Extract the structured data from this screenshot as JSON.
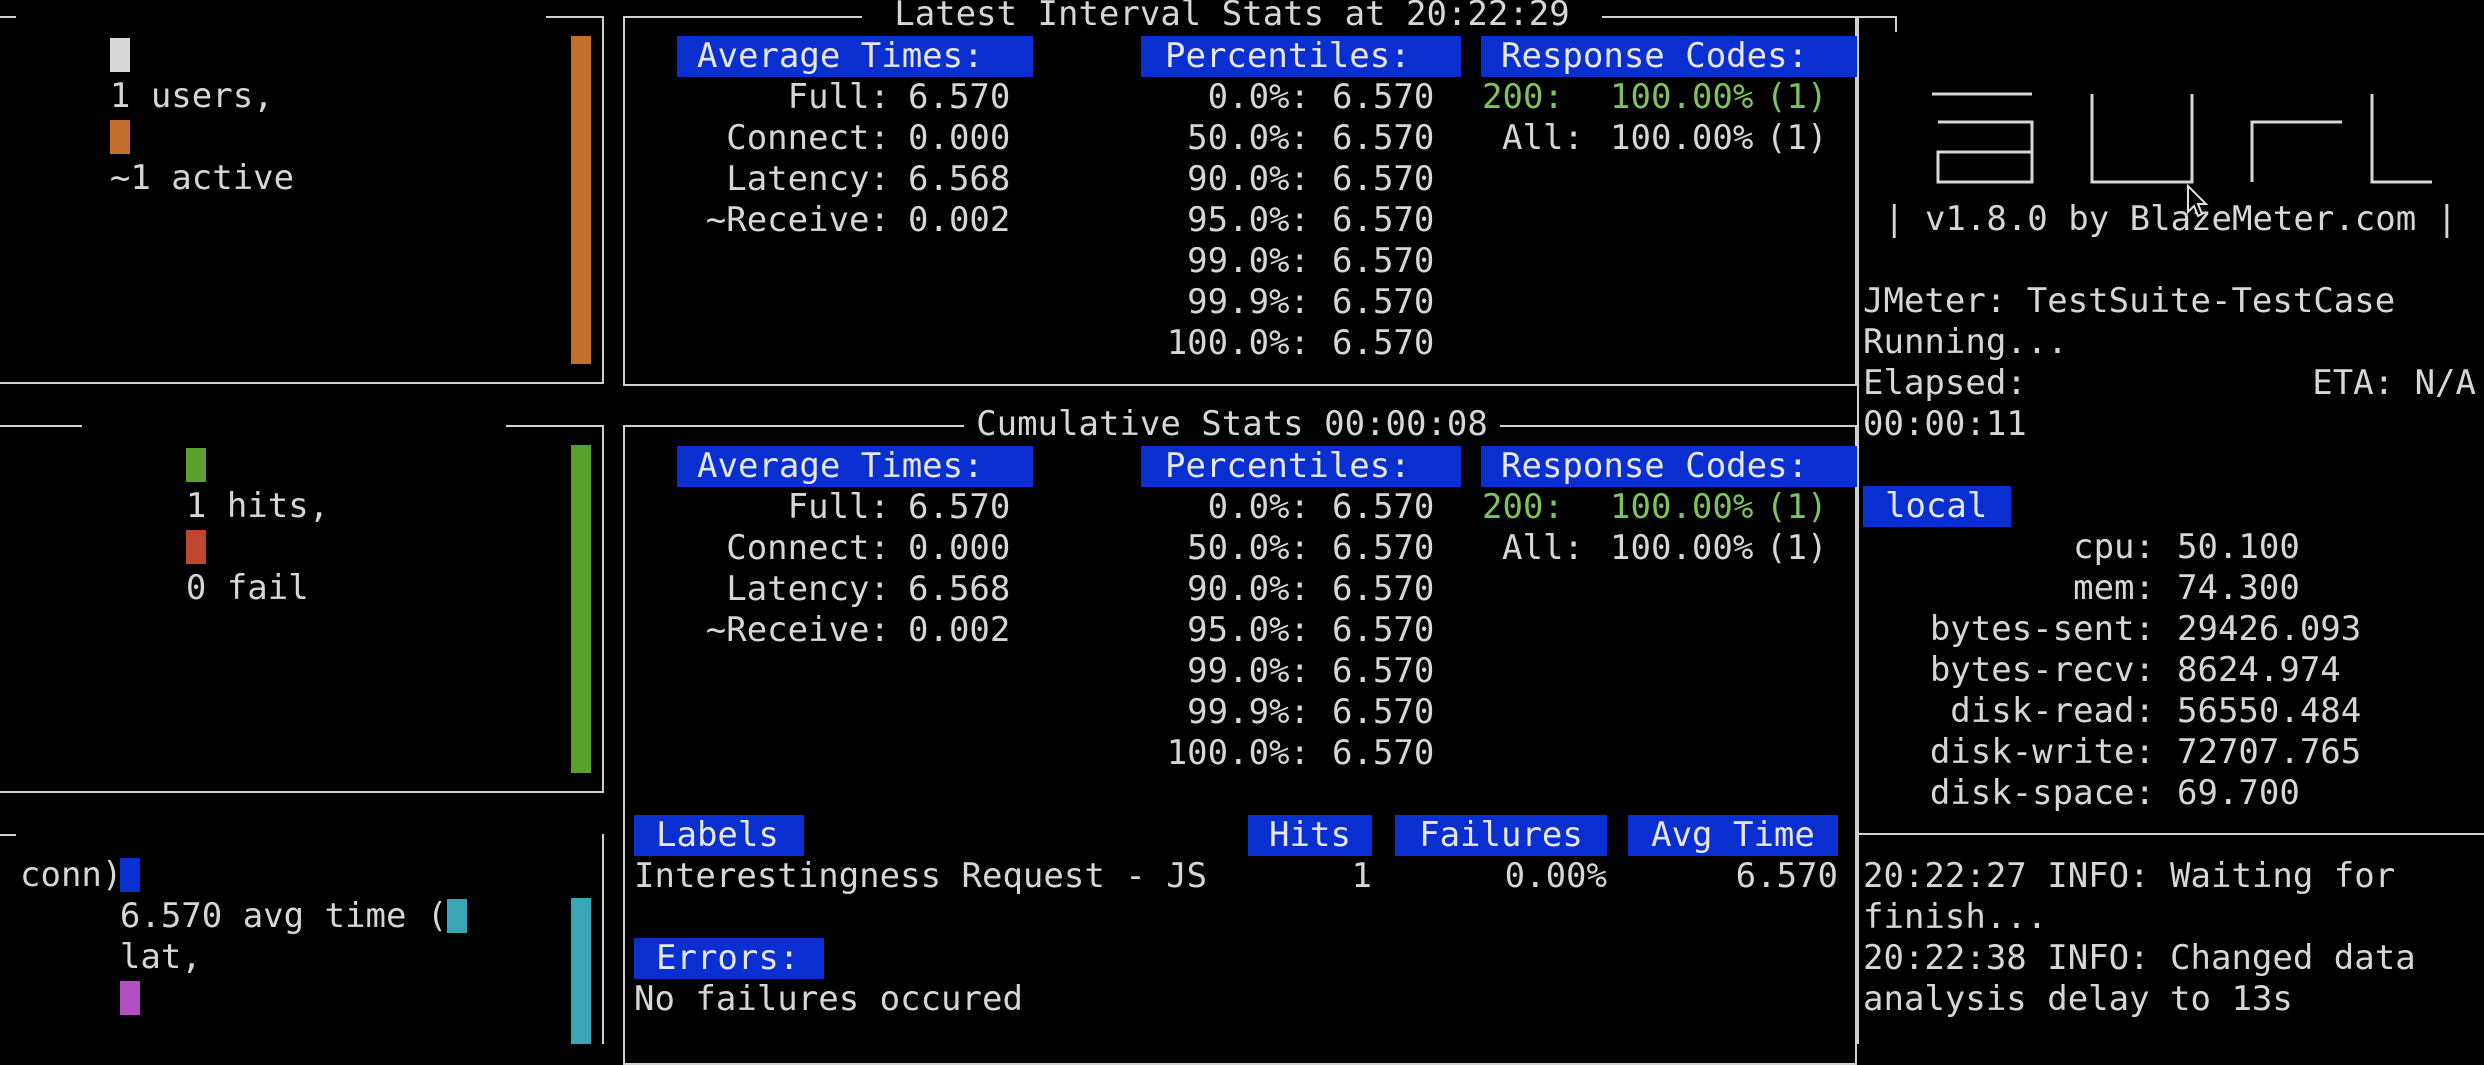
{
  "left": {
    "users_label": "1 users,",
    "active_label": "~1 active",
    "hits_label": "1 hits,",
    "fail_label": "0 fail",
    "avg_label": "6.570 avg time (",
    "lat_label": "lat,",
    "conn_label": "conn)",
    "colors": {
      "users": "#d8d8d8",
      "active": "#c46e2c",
      "hits": "#5aa02c",
      "fail": "#c0452f",
      "avg": "#0a2fd0",
      "lat": "#3aa5b5",
      "conn": "#b04fc0"
    }
  },
  "latest": {
    "title": "Latest Interval Stats at 20:22:29",
    "avg_header": "Average Times:",
    "avg": [
      {
        "label": "Full:",
        "value": "6.570"
      },
      {
        "label": "Connect:",
        "value": "0.000"
      },
      {
        "label": "Latency:",
        "value": "6.568"
      },
      {
        "label": "~Receive:",
        "value": "0.002"
      }
    ],
    "pct_header": "Percentiles:",
    "pct": [
      {
        "p": "0.0%:",
        "v": "6.570"
      },
      {
        "p": "50.0%:",
        "v": "6.570"
      },
      {
        "p": "90.0%:",
        "v": "6.570"
      },
      {
        "p": "95.0%:",
        "v": "6.570"
      },
      {
        "p": "99.0%:",
        "v": "6.570"
      },
      {
        "p": "99.9%:",
        "v": "6.570"
      },
      {
        "p": "100.0%:",
        "v": "6.570"
      }
    ],
    "rc_header": "Response Codes:",
    "rc": [
      {
        "code": "200:",
        "pct": "100.00%",
        "count": "(1)"
      },
      {
        "code": "All:",
        "pct": "100.00%",
        "count": "(1)"
      }
    ]
  },
  "cumulative": {
    "title": "Cumulative Stats 00:00:08",
    "avg_header": "Average Times:",
    "avg": [
      {
        "label": "Full:",
        "value": "6.570"
      },
      {
        "label": "Connect:",
        "value": "0.000"
      },
      {
        "label": "Latency:",
        "value": "6.568"
      },
      {
        "label": "~Receive:",
        "value": "0.002"
      }
    ],
    "pct_header": "Percentiles:",
    "pct": [
      {
        "p": "0.0%:",
        "v": "6.570"
      },
      {
        "p": "50.0%:",
        "v": "6.570"
      },
      {
        "p": "90.0%:",
        "v": "6.570"
      },
      {
        "p": "95.0%:",
        "v": "6.570"
      },
      {
        "p": "99.0%:",
        "v": "6.570"
      },
      {
        "p": "99.9%:",
        "v": "6.570"
      },
      {
        "p": "100.0%:",
        "v": "6.570"
      }
    ],
    "rc_header": "Response Codes:",
    "rc": [
      {
        "code": "200:",
        "pct": "100.00%",
        "count": "(1)"
      },
      {
        "code": "All:",
        "pct": "100.00%",
        "count": "(1)"
      }
    ]
  },
  "labels_table": {
    "headers": {
      "labels": "Labels",
      "hits": "Hits",
      "failures": "Failures",
      "avg_time": "Avg Time"
    },
    "rows": [
      {
        "label": "Interestingness Request - JS",
        "hits": "1",
        "failures": "0.00%",
        "avg_time": "6.570"
      }
    ]
  },
  "errors": {
    "header": "Errors:",
    "message": "No failures occured"
  },
  "sidebar": {
    "version": "| v1.8.0 by BlazeMeter.com |",
    "executor": "JMeter: TestSuite-TestCase",
    "status": "Running...",
    "elapsed_label": "Elapsed:",
    "eta": "ETA: N/A",
    "elapsed": "00:00:11",
    "local_header": "local",
    "metrics": [
      {
        "name": "cpu:",
        "value": "50.100"
      },
      {
        "name": "mem:",
        "value": "74.300"
      },
      {
        "name": "bytes-sent:",
        "value": "29426.093"
      },
      {
        "name": "bytes-recv:",
        "value": "8624.974"
      },
      {
        "name": "disk-read:",
        "value": "56550.484"
      },
      {
        "name": "disk-write:",
        "value": "72707.765"
      },
      {
        "name": "disk-space:",
        "value": "69.700"
      }
    ],
    "log": [
      "20:22:27 INFO: Waiting for",
      "finish...",
      "20:22:38 INFO: Changed data",
      "analysis delay to 13s"
    ]
  }
}
